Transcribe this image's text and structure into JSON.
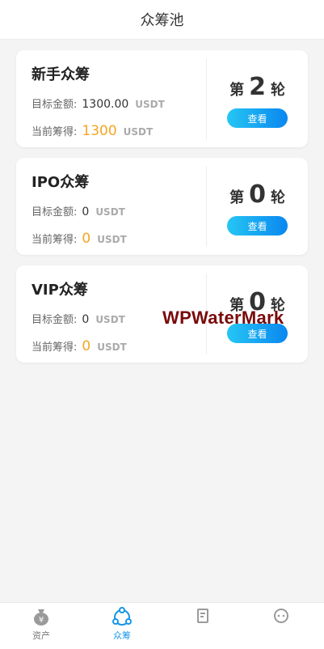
{
  "header": {
    "title": "众筹池"
  },
  "labels": {
    "target": "目标金额:",
    "current": "当前筹得:",
    "round_prefix": "第",
    "round_suffix": "轮",
    "view": "查看"
  },
  "cards": [
    {
      "name": "新手众筹",
      "target": "1300.00",
      "target_unit": "USDT",
      "current": "1300",
      "current_unit": "USDT",
      "round": "2"
    },
    {
      "name": "IPO众筹",
      "target": "0",
      "target_unit": "USDT",
      "current": "0",
      "current_unit": "USDT",
      "round": "0"
    },
    {
      "name": "VIP众筹",
      "target": "0",
      "target_unit": "USDT",
      "current": "0",
      "current_unit": "USDT",
      "round": "0"
    }
  ],
  "watermark": "WPWaterMark",
  "tabbar": {
    "items": [
      {
        "label": "资产",
        "icon": "money-bag-icon"
      },
      {
        "label": "众筹",
        "icon": "crowdfund-icon",
        "active": true
      },
      {
        "label": "",
        "icon": "document-icon"
      },
      {
        "label": "",
        "icon": "message-icon"
      }
    ]
  },
  "colors": {
    "accent": "#1596e8",
    "highlight": "#f5a623",
    "button_start": "#26c6f4",
    "button_end": "#0a87ef"
  }
}
